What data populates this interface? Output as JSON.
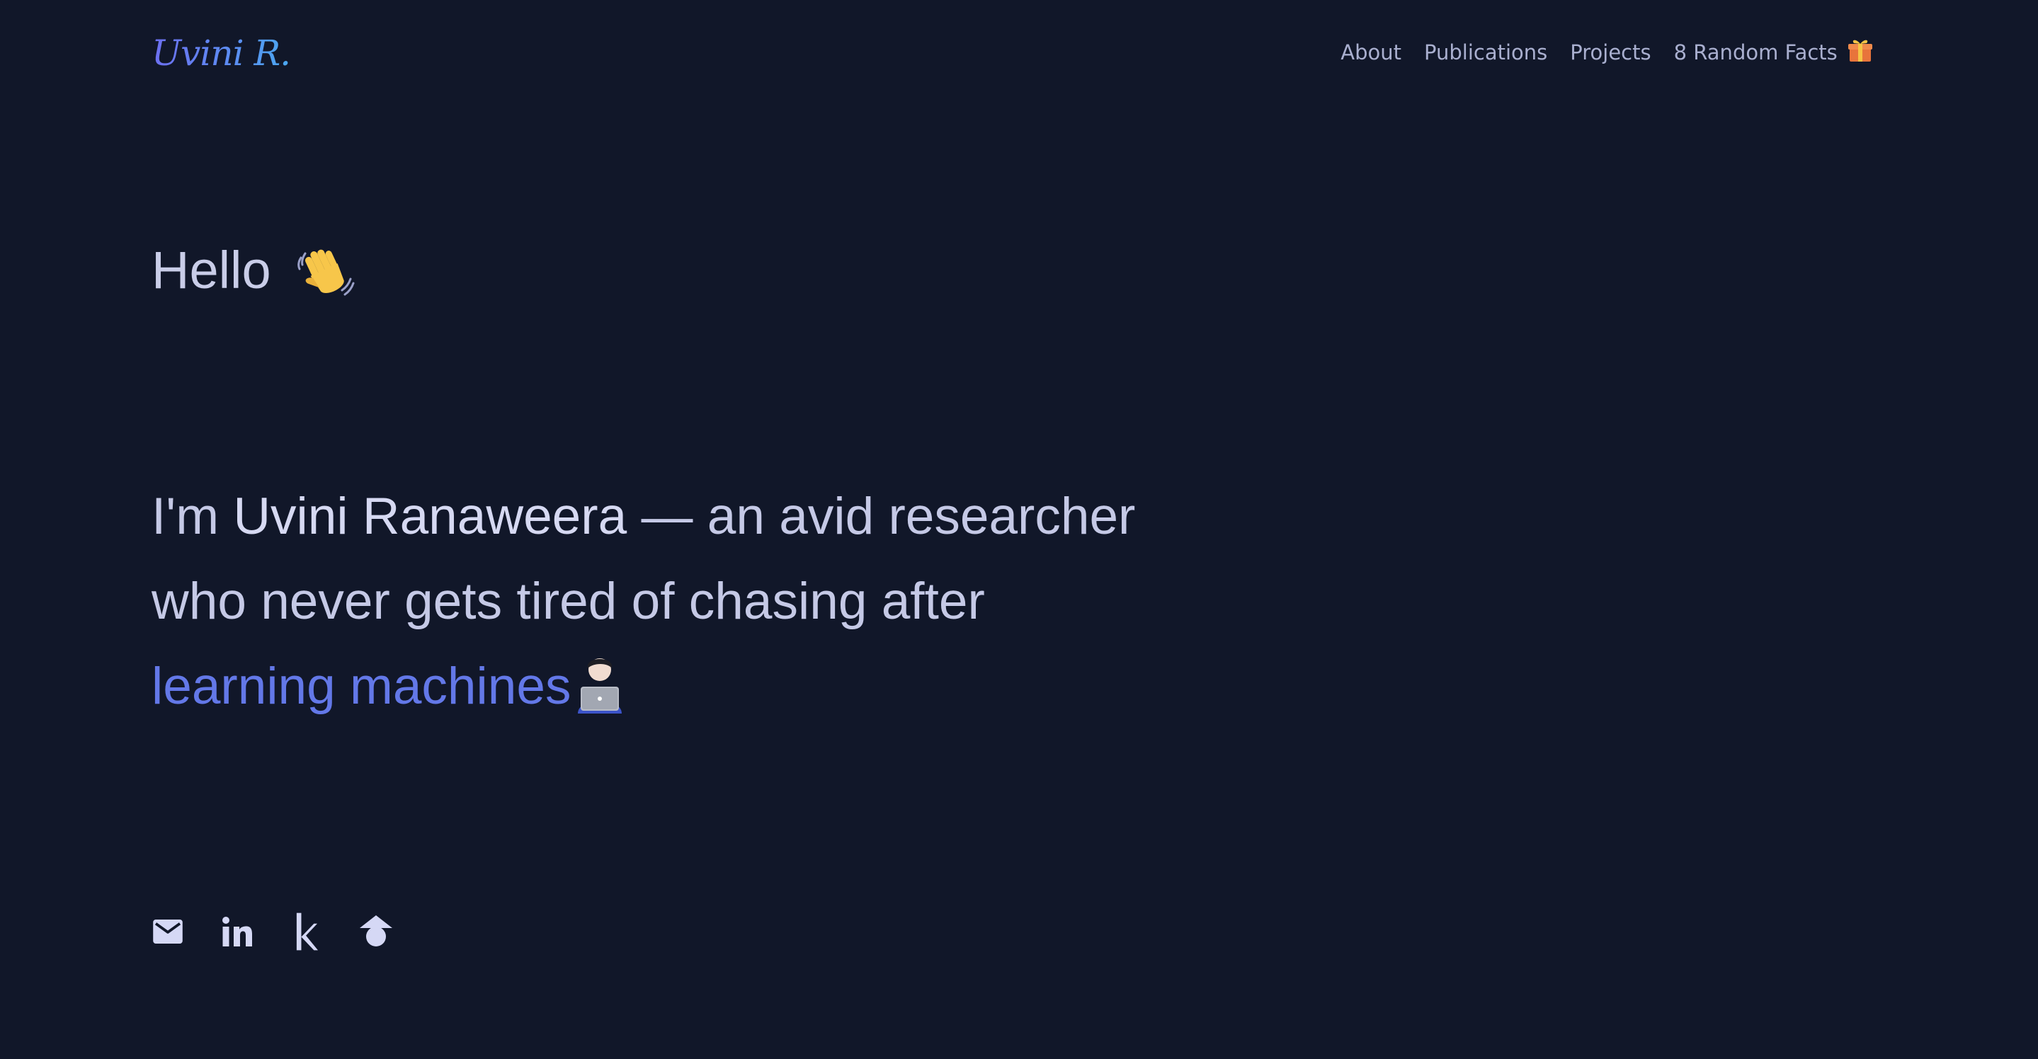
{
  "header": {
    "logo": "Uvini R.",
    "nav": [
      {
        "label": "About"
      },
      {
        "label": "Publications"
      },
      {
        "label": "Projects"
      },
      {
        "label": "8 Random Facts",
        "icon": "gift-icon"
      }
    ]
  },
  "hero": {
    "greeting": "Hello",
    "greeting_icon": "waving-hand-icon",
    "intro_prefix": "I'm ",
    "intro_name": "Uvini Ranaweera",
    "intro_line1_rest": " — an avid researcher",
    "intro_line2": "who never gets tired of chasing after",
    "intro_accent": "learning machines",
    "intro_icon": "technologist-laptop-icon"
  },
  "social": [
    {
      "icon": "email-icon"
    },
    {
      "icon": "linkedin-icon"
    },
    {
      "icon": "kaggle-icon"
    },
    {
      "icon": "google-scholar-icon"
    }
  ],
  "colors": {
    "background": "#111729",
    "text": "#c7cbe8",
    "accent": "#6378e8",
    "nav_text": "#a9afcf",
    "icon": "#d5d8f5"
  }
}
